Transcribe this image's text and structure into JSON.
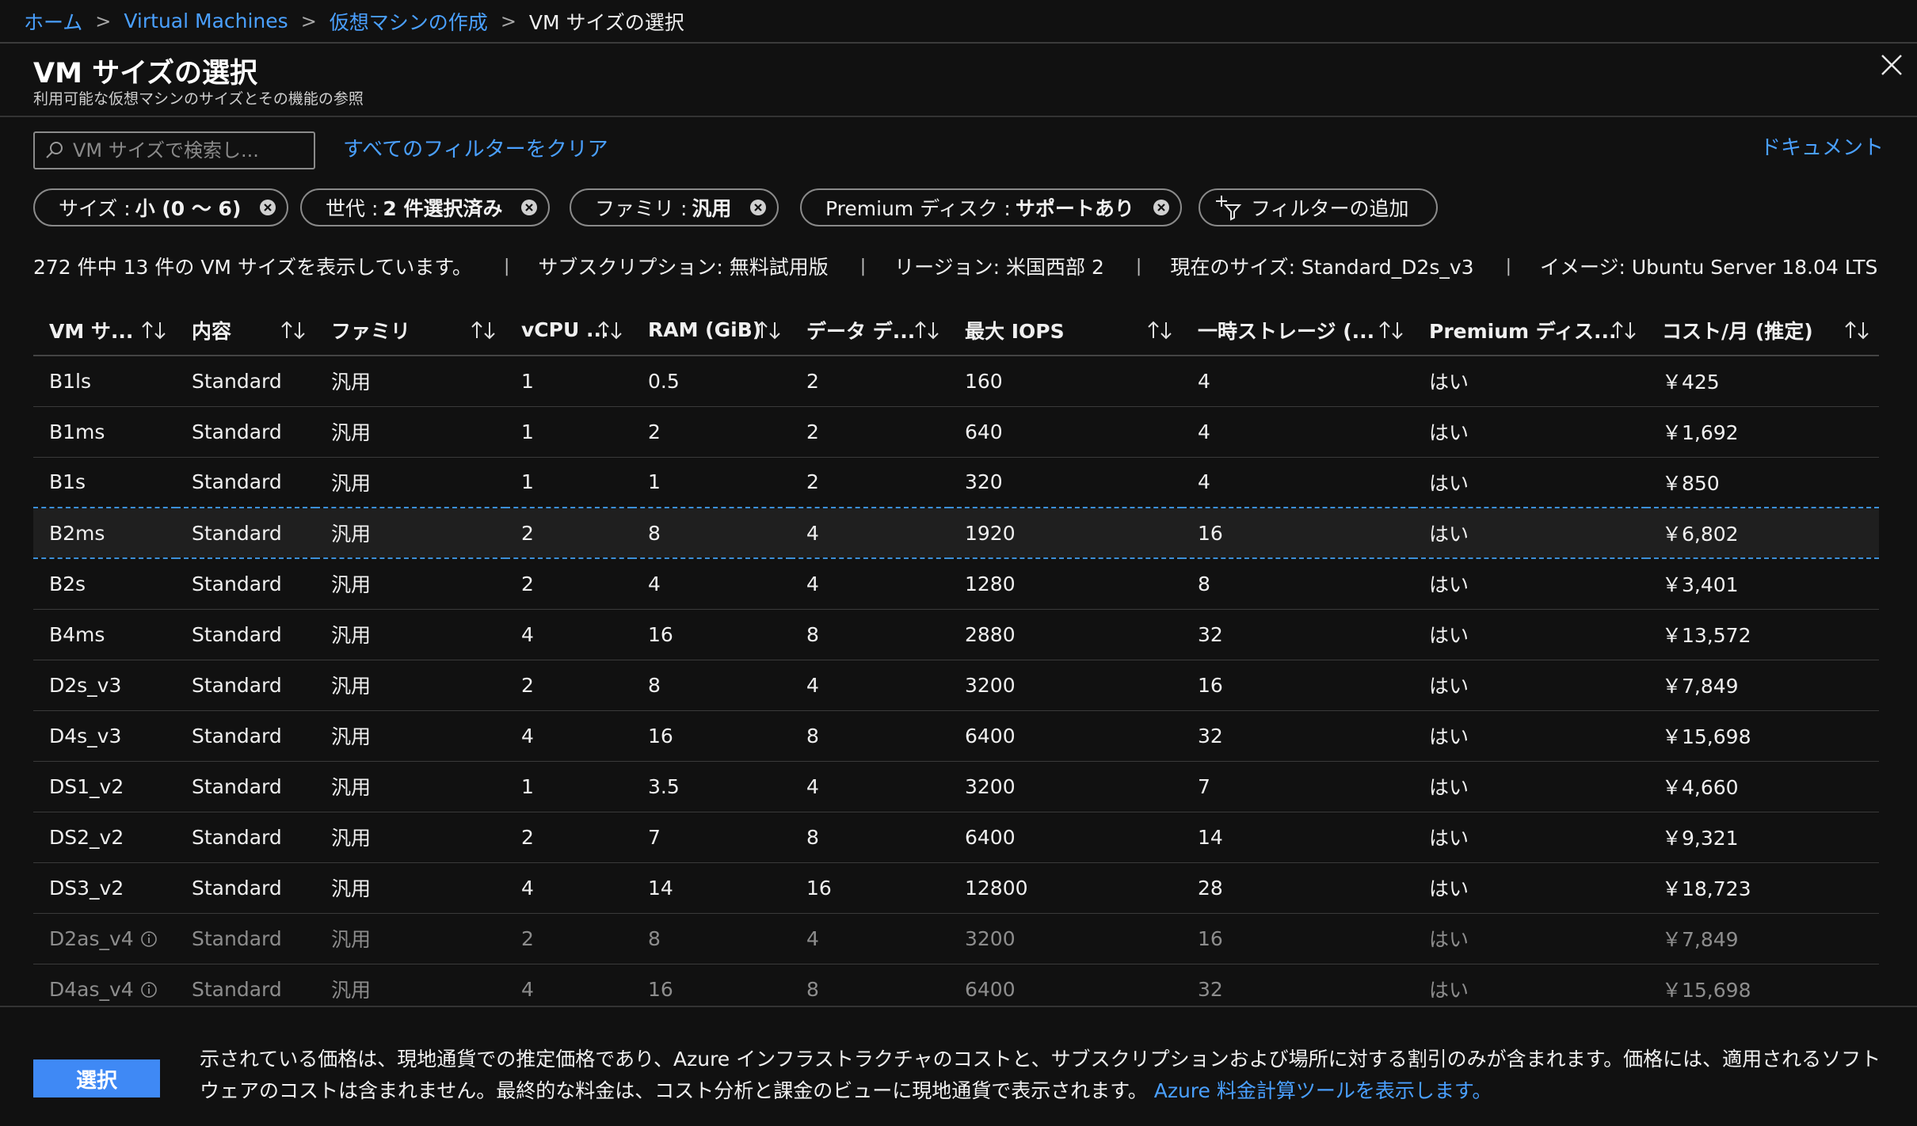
{
  "breadcrumb": {
    "items": [
      "ホーム",
      "Virtual Machines",
      "仮想マシンの作成"
    ],
    "current": "VM サイズの選択",
    "separator": ">"
  },
  "panel": {
    "title": "VM サイズの選択",
    "subtitle": "利用可能な仮想マシンのサイズとその機能の参照"
  },
  "search": {
    "placeholder": "VM サイズで検索し...",
    "value": ""
  },
  "clear_filters": "すべてのフィルターをクリア",
  "docs_link": "ドキュメント",
  "filters": [
    {
      "label": "サイズ :",
      "value": "小 (0 〜 6)"
    },
    {
      "label": "世代 :",
      "value": "2 件選択済み"
    },
    {
      "label": "ファミリ :",
      "value": "汎用"
    },
    {
      "label": "Premium ディスク :",
      "value": "サポートあり"
    }
  ],
  "add_filter": "フィルターの追加",
  "summary": {
    "count": "272 件中 13 件の VM サイズを表示しています。",
    "subscription": "サブスクリプション: 無料試用版",
    "region": "リージョン: 米国西部 2",
    "current_size": "現在のサイズ: Standard_D2s_v3",
    "image": "イメージ: Ubuntu Server 18.04 LTS",
    "separator": "|"
  },
  "table": {
    "columns": [
      "VM サ...",
      "内容",
      "ファミリ",
      "vCPU ...",
      "RAM (GiB)",
      "データ デ...",
      "最大 IOPS",
      "一時ストレージ (...",
      "Premium ディス...",
      "コスト/月 (推定)"
    ],
    "rows": [
      [
        "B1ls",
        "Standard",
        "汎用",
        "1",
        "0.5",
        "2",
        "160",
        "4",
        "はい",
        "￥425"
      ],
      [
        "B1ms",
        "Standard",
        "汎用",
        "1",
        "2",
        "2",
        "640",
        "4",
        "はい",
        "￥1,692"
      ],
      [
        "B1s",
        "Standard",
        "汎用",
        "1",
        "1",
        "2",
        "320",
        "4",
        "はい",
        "￥850"
      ],
      [
        "B2ms",
        "Standard",
        "汎用",
        "2",
        "8",
        "4",
        "1920",
        "16",
        "はい",
        "￥6,802"
      ],
      [
        "B2s",
        "Standard",
        "汎用",
        "2",
        "4",
        "4",
        "1280",
        "8",
        "はい",
        "￥3,401"
      ],
      [
        "B4ms",
        "Standard",
        "汎用",
        "4",
        "16",
        "8",
        "2880",
        "32",
        "はい",
        "￥13,572"
      ],
      [
        "D2s_v3",
        "Standard",
        "汎用",
        "2",
        "8",
        "4",
        "3200",
        "16",
        "はい",
        "￥7,849"
      ],
      [
        "D4s_v3",
        "Standard",
        "汎用",
        "4",
        "16",
        "8",
        "6400",
        "32",
        "はい",
        "￥15,698"
      ],
      [
        "DS1_v2",
        "Standard",
        "汎用",
        "1",
        "3.5",
        "4",
        "3200",
        "7",
        "はい",
        "￥4,660"
      ],
      [
        "DS2_v2",
        "Standard",
        "汎用",
        "2",
        "7",
        "8",
        "6400",
        "14",
        "はい",
        "￥9,321"
      ],
      [
        "DS3_v2",
        "Standard",
        "汎用",
        "4",
        "14",
        "16",
        "12800",
        "28",
        "はい",
        "￥18,723"
      ],
      [
        "D2as_v4",
        "Standard",
        "汎用",
        "2",
        "8",
        "4",
        "3200",
        "16",
        "はい",
        "￥7,849"
      ],
      [
        "D4as_v4",
        "Standard",
        "汎用",
        "4",
        "16",
        "8",
        "6400",
        "32",
        "はい",
        "￥15,698"
      ]
    ],
    "selected_row": 3,
    "disabled_rows": [
      11,
      12
    ],
    "info_rows": [
      11,
      12
    ]
  },
  "footer": {
    "select_label": "選択",
    "note": "示されている価格は、現地通貨での推定価格であり、Azure インフラストラクチャのコストと、サブスクリプションおよび場所に対する割引のみが含まれます。価格には、適用されるソフトウェアのコストは含まれません。最終的な料金は、コスト分析と課金のビューに現地通貨で表示されます。",
    "link": "Azure 料金計算ツールを表示します。"
  },
  "colors": {
    "accent": "#4aa0ff",
    "primary_button": "#3f89f5",
    "background": "#111111",
    "selected_border": "#3b8fd8"
  },
  "icons": {
    "search": "search-icon",
    "close": "close-icon",
    "pill_close": "circle-x-icon",
    "add_filter": "add-filter-icon",
    "sort": "sort-arrows-icon",
    "info": "info-icon"
  }
}
